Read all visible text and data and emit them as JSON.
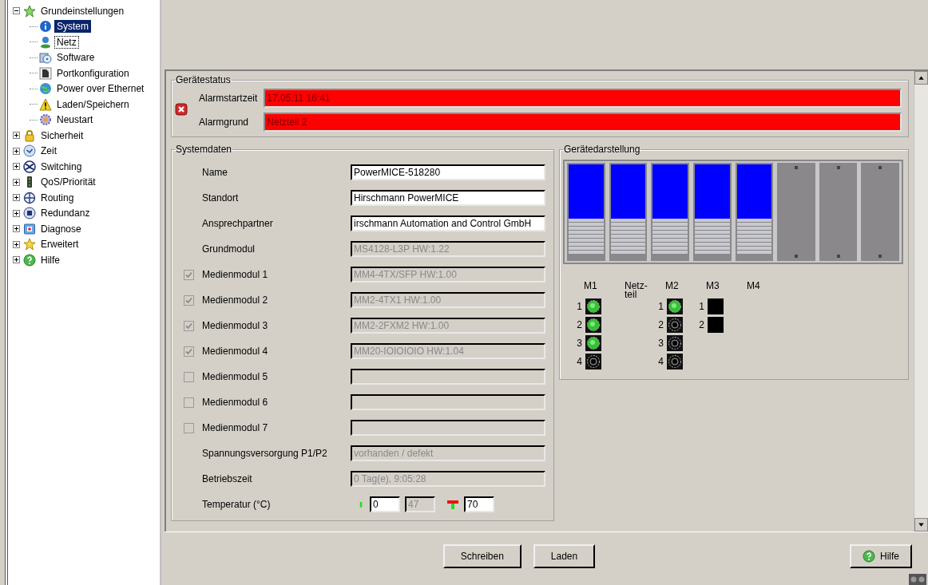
{
  "tree": [
    {
      "label": "Grundeinstellungen",
      "expanded": true,
      "selected": false,
      "children": [
        {
          "label": "System",
          "selected": true,
          "focused": false
        },
        {
          "label": "Netz",
          "selected": false,
          "focused": true
        },
        {
          "label": "Software",
          "selected": false,
          "focused": false
        },
        {
          "label": "Portkonfiguration",
          "selected": false,
          "focused": false
        },
        {
          "label": "Power over Ethernet",
          "selected": false,
          "focused": false
        },
        {
          "label": "Laden/Speichern",
          "selected": false,
          "focused": false
        },
        {
          "label": "Neustart",
          "selected": false,
          "focused": false
        }
      ]
    },
    {
      "label": "Sicherheit",
      "expanded": false,
      "selected": false
    },
    {
      "label": "Zeit",
      "expanded": false,
      "selected": false
    },
    {
      "label": "Switching",
      "expanded": false,
      "selected": false
    },
    {
      "label": "QoS/Priorität",
      "expanded": false,
      "selected": false
    },
    {
      "label": "Routing",
      "expanded": false,
      "selected": false
    },
    {
      "label": "Redundanz",
      "expanded": false,
      "selected": false
    },
    {
      "label": "Diagnose",
      "expanded": false,
      "selected": false
    },
    {
      "label": "Erweitert",
      "expanded": false,
      "selected": false
    },
    {
      "label": "Hilfe",
      "expanded": false,
      "selected": false
    }
  ],
  "status": {
    "title": "Gerätestatus",
    "fields": [
      {
        "label": "Alarmstartzeit",
        "value": "17.05.11 16:41",
        "alarm": true
      },
      {
        "label": "Alarmgrund",
        "value": "Netzteil 2",
        "alarm": true
      }
    ]
  },
  "systemdaten": {
    "title": "Systemdaten",
    "rows": [
      {
        "kind": "field",
        "label": "Name",
        "value": "PowerMICE-518280",
        "disabled": false
      },
      {
        "kind": "field",
        "label": "Standort",
        "value": "Hirschmann PowerMICE",
        "disabled": false
      },
      {
        "kind": "field",
        "label": "Ansprechpartner",
        "value": "irschmann Automation and Control GmbH",
        "disabled": false
      },
      {
        "kind": "field",
        "label": "Grundmodul",
        "value": "MS4128-L3P HW:1.22",
        "disabled": true
      },
      {
        "kind": "check",
        "label": "Medienmodul 1",
        "checked": true,
        "value": "MM4-4TX/SFP HW:1.00",
        "disabled": true
      },
      {
        "kind": "check",
        "label": "Medienmodul 2",
        "checked": true,
        "value": "MM2-4TX1 HW:1.00",
        "disabled": true
      },
      {
        "kind": "check",
        "label": "Medienmodul 3",
        "checked": true,
        "value": "MM2-2FXM2 HW:1.00",
        "disabled": true
      },
      {
        "kind": "check",
        "label": "Medienmodul 4",
        "checked": true,
        "value": "MM20-IOIOIOIO HW:1.04",
        "disabled": true
      },
      {
        "kind": "check",
        "label": "Medienmodul 5",
        "checked": false,
        "disabled": true
      },
      {
        "kind": "check",
        "label": "Medienmodul 6",
        "checked": false,
        "disabled": true
      },
      {
        "kind": "check",
        "label": "Medienmodul 7",
        "checked": false,
        "disabled": true
      },
      {
        "kind": "field",
        "label": "Spannungsversorgung P1/P2",
        "value": "vorhanden / defekt",
        "disabled": true
      },
      {
        "kind": "field",
        "label": "Betriebszeit",
        "value": "0 Tag(e), 9:05:28",
        "disabled": true
      },
      {
        "kind": "temperature",
        "label": "Temperatur (°C)",
        "min": "0",
        "current": "47",
        "max": "70"
      }
    ]
  },
  "device": {
    "title": "Gerätedarstellung",
    "slots": [
      {
        "kind": "module"
      },
      {
        "kind": "module"
      },
      {
        "kind": "module"
      },
      {
        "kind": "module"
      },
      {
        "kind": "module"
      },
      {
        "kind": "empty"
      },
      {
        "kind": "empty"
      },
      {
        "kind": "empty"
      }
    ],
    "columns": [
      {
        "label": "M1",
        "ports": [
          {
            "number": "1",
            "kind": "up"
          },
          {
            "number": "2",
            "kind": "up"
          },
          {
            "number": "3",
            "kind": "up"
          },
          {
            "number": "4",
            "kind": "down"
          }
        ]
      },
      {
        "label": "Netz-\nteil"
      },
      {
        "label": "M2",
        "ports": [
          {
            "number": "1",
            "kind": "up"
          },
          {
            "number": "2",
            "kind": "down"
          },
          {
            "number": "3",
            "kind": "down"
          },
          {
            "number": "4",
            "kind": "down"
          }
        ]
      },
      {
        "label": "M3",
        "ports": [
          {
            "number": "1",
            "kind": "none"
          },
          {
            "number": "2",
            "kind": "none"
          }
        ]
      },
      {
        "label": "M4"
      }
    ]
  },
  "buttons": [
    {
      "label": "Schreiben"
    },
    {
      "label": "Laden"
    }
  ],
  "help_button": {
    "label": "Hilfe"
  }
}
